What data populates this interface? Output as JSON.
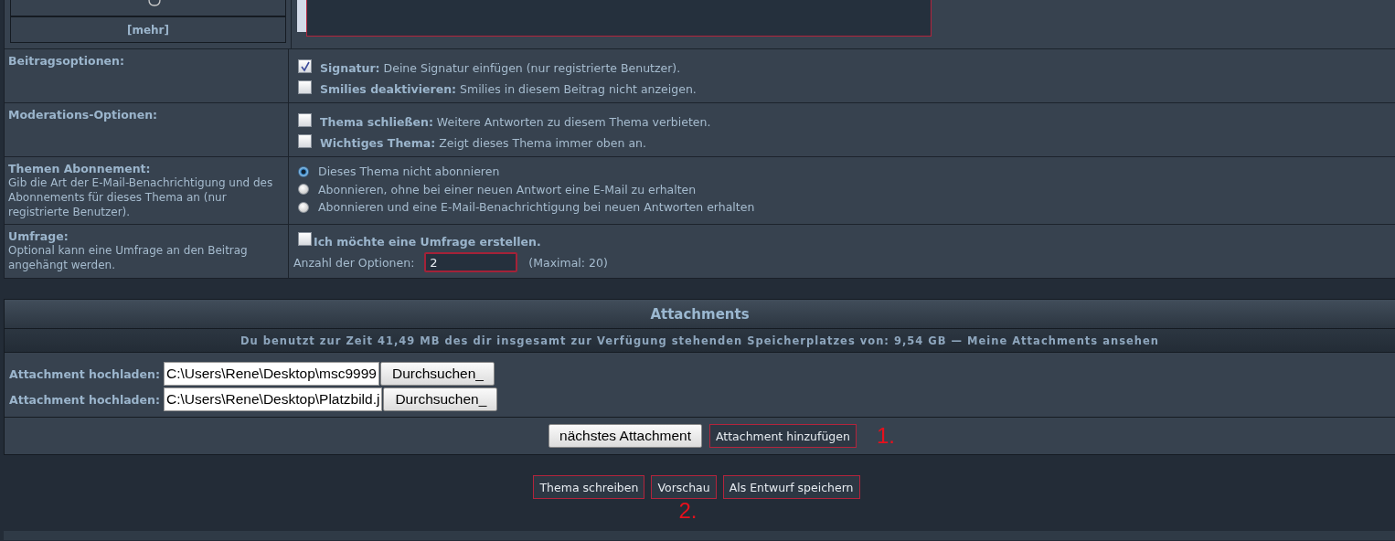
{
  "smilies_panel": {
    "more_link": "[mehr]"
  },
  "options": [
    {
      "kind": "checkboxes",
      "label": "Beitragsoptionen:",
      "items": [
        {
          "label": "Signatur:",
          "text": "Deine Signatur einfügen (nur registrierte Benutzer).",
          "checked": true
        },
        {
          "label": "Smilies deaktivieren:",
          "text": "Smilies in diesem Beitrag nicht anzeigen.",
          "checked": false
        }
      ]
    },
    {
      "kind": "checkboxes",
      "label": "Moderations-Optionen:",
      "items": [
        {
          "label": "Thema schließen:",
          "text": "Weitere Antworten zu diesem Thema verbieten.",
          "checked": false
        },
        {
          "label": "Wichtiges Thema:",
          "text": "Zeigt dieses Thema immer oben an.",
          "checked": false
        }
      ]
    },
    {
      "kind": "radios",
      "label": "Themen Abonnement:",
      "description": "Gib die Art der E-Mail-Benachrichtigung und des Abonnements für dieses Thema an (nur registrierte Benutzer).",
      "items": [
        {
          "text": "Dieses Thema nicht abonnieren",
          "selected": true
        },
        {
          "text": "Abonnieren, ohne bei einer neuen Antwort eine E-Mail zu erhalten",
          "selected": false
        },
        {
          "text": "Abonnieren und eine E-Mail-Benachrichtigung bei neuen Antworten erhalten",
          "selected": false
        }
      ]
    },
    {
      "kind": "poll",
      "label": "Umfrage:",
      "description": "Optional kann eine Umfrage an den Beitrag angehängt werden.",
      "checkbox": {
        "label": "Ich möchte eine Umfrage erstellen.",
        "checked": false
      },
      "count_label": "Anzahl der Optionen:",
      "count_value": "2",
      "max_note": "(Maximal: 20)"
    }
  ],
  "attachments": {
    "title": "Attachments",
    "usage_text": "Du benutzt zur Zeit 41,49 MB des dir insgesamt zur Verfügung stehenden Speicherplatzes von: 9,54 GB —",
    "usage_link": "Meine Attachments ansehen",
    "uploads": [
      {
        "label": "Attachment hochladen:",
        "value": "C:\\Users\\Rene\\Desktop\\msc9999",
        "browse": "Durchsuchen_"
      },
      {
        "label": "Attachment hochladen:",
        "value": "C:\\Users\\Rene\\Desktop\\Platzbild.j",
        "browse": "Durchsuchen_"
      }
    ],
    "next_button": "nächstes Attachment",
    "add_button": "Attachment hinzufügen",
    "add_marker": "1."
  },
  "actions": {
    "buttons": [
      {
        "label": "Thema schreiben"
      },
      {
        "label": "Vorschau",
        "marker": "2."
      },
      {
        "label": "Als Entwurf speichern"
      }
    ]
  }
}
